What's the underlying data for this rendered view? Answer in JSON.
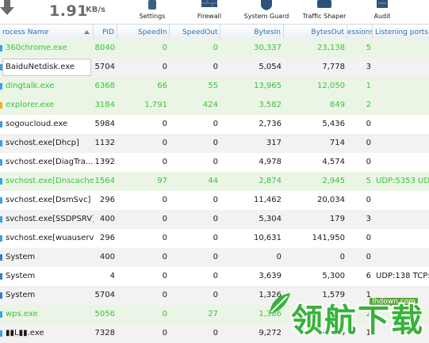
{
  "toolbar": {
    "speed_value": "1.91",
    "speed_unit": "KB/s",
    "buttons": [
      {
        "label": "Settings",
        "icon": "settings-icon"
      },
      {
        "label": "Firewall",
        "icon": "firewall-icon"
      },
      {
        "label": "System Guard",
        "icon": "system-guard-icon"
      },
      {
        "label": "Traffic Shaper",
        "icon": "traffic-shaper-icon"
      },
      {
        "label": "Audit",
        "icon": "audit-icon"
      }
    ]
  },
  "table": {
    "columns": [
      "rocess Name",
      "PID",
      "SpeedIn",
      "SpeedOut",
      "BytesIn",
      "BytesOut",
      "essions",
      "Listening ports"
    ],
    "sort_column": "rocess Name",
    "rows": [
      {
        "name": "360chrome.exe",
        "pid": "8040",
        "speed_in": "0",
        "speed_out": "0",
        "bytes_in": "30,337",
        "bytes_out": "23,138",
        "sessions": "5",
        "ports": "",
        "color": "green",
        "icon": "file-icon"
      },
      {
        "name": "BaiduNetdisk.exe",
        "pid": "5704",
        "speed_in": "0",
        "speed_out": "0",
        "bytes_in": "5,054",
        "bytes_out": "7,778",
        "sessions": "3",
        "ports": "",
        "color": "dark",
        "icon": "file-icon",
        "selected": true
      },
      {
        "name": "dingtalk.exe",
        "pid": "6368",
        "speed_in": "66",
        "speed_out": "55",
        "bytes_in": "13,965",
        "bytes_out": "12,050",
        "sessions": "1",
        "ports": "",
        "color": "green",
        "icon": "file-icon"
      },
      {
        "name": "explorer.exe",
        "pid": "3184",
        "speed_in": "1,791",
        "speed_out": "424",
        "bytes_in": "3,582",
        "bytes_out": "849",
        "sessions": "2",
        "ports": "",
        "color": "green",
        "icon": "folder-icon"
      },
      {
        "name": "sogoucloud.exe",
        "pid": "5984",
        "speed_in": "0",
        "speed_out": "0",
        "bytes_in": "2,736",
        "bytes_out": "5,436",
        "sessions": "0",
        "ports": "",
        "color": "dark",
        "icon": "file-icon"
      },
      {
        "name": "svchost.exe[Dhcp]",
        "pid": "1132",
        "speed_in": "0",
        "speed_out": "0",
        "bytes_in": "317",
        "bytes_out": "714",
        "sessions": "0",
        "ports": "",
        "color": "dark",
        "icon": "file-icon"
      },
      {
        "name": "svchost.exe[DiagTra...",
        "pid": "1392",
        "speed_in": "0",
        "speed_out": "0",
        "bytes_in": "4,978",
        "bytes_out": "4,574",
        "sessions": "0",
        "ports": "",
        "color": "dark",
        "icon": "file-icon"
      },
      {
        "name": "svchost.exe[Dnscache]",
        "pid": "1564",
        "speed_in": "97",
        "speed_out": "44",
        "bytes_in": "2,874",
        "bytes_out": "2,945",
        "sessions": "5",
        "ports": "UDP:5353 UDP",
        "color": "green",
        "icon": "file-icon"
      },
      {
        "name": "svchost.exe[DsmSvc]",
        "pid": "296",
        "speed_in": "0",
        "speed_out": "0",
        "bytes_in": "11,462",
        "bytes_out": "20,034",
        "sessions": "0",
        "ports": "",
        "color": "dark",
        "icon": "file-icon"
      },
      {
        "name": "svchost.exe[SSDPSRV]",
        "pid": "400",
        "speed_in": "0",
        "speed_out": "0",
        "bytes_in": "5,304",
        "bytes_out": "179",
        "sessions": "3",
        "ports": "",
        "color": "dark",
        "icon": "file-icon"
      },
      {
        "name": "svchost.exe[wuauserv]",
        "pid": "296",
        "speed_in": "0",
        "speed_out": "0",
        "bytes_in": "10,631",
        "bytes_out": "141,950",
        "sessions": "0",
        "ports": "",
        "color": "dark",
        "icon": "file-icon"
      },
      {
        "name": "System",
        "pid": "400",
        "speed_in": "0",
        "speed_out": "0",
        "bytes_in": "0",
        "bytes_out": "0",
        "sessions": "0",
        "ports": "",
        "color": "dark",
        "icon": "system-icon"
      },
      {
        "name": "System",
        "pid": "4",
        "speed_in": "0",
        "speed_out": "0",
        "bytes_in": "3,639",
        "bytes_out": "5,300",
        "sessions": "6",
        "ports": "UDP:138 TCP:1",
        "color": "dark",
        "icon": "system-icon"
      },
      {
        "name": "System",
        "pid": "5704",
        "speed_in": "0",
        "speed_out": "0",
        "bytes_in": "1,326",
        "bytes_out": "1,579",
        "sessions": "1",
        "ports": "",
        "color": "dark",
        "icon": "system-icon"
      },
      {
        "name": "wps.exe",
        "pid": "5056",
        "speed_in": "0",
        "speed_out": "27",
        "bytes_in": "1,386",
        "bytes_out": "",
        "sessions": "2",
        "ports": "",
        "color": "green",
        "icon": "file-icon"
      },
      {
        "name": "▮▮L▮▮.exe",
        "pid": "7328",
        "speed_in": "0",
        "speed_out": "0",
        "bytes_in": "9,272",
        "bytes_out": "18,796",
        "sessions": "1",
        "ports": "",
        "color": "dark",
        "icon": "file-icon"
      }
    ]
  },
  "watermark": {
    "text": "领航下载",
    "url": "lhdown.com",
    "color": "#37b23a"
  }
}
